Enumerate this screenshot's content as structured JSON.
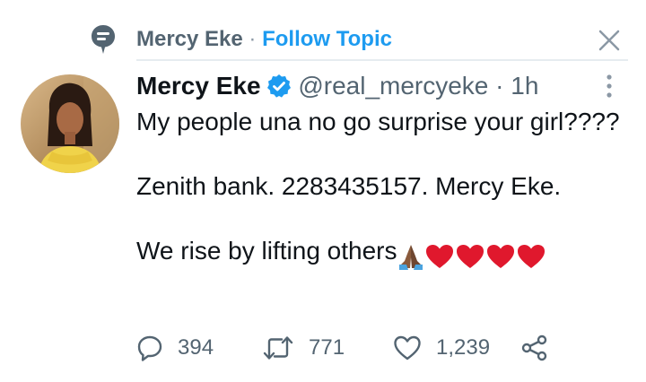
{
  "topic": {
    "name": "Mercy Eke",
    "separator": "·",
    "follow_label": "Follow Topic"
  },
  "tweet": {
    "author_name": "Mercy Eke",
    "handle": "@real_mercyeke",
    "separator": "·",
    "time": "1h",
    "text_line1": "My people una no go surprise your girl????",
    "text_line2": "Zenith bank. 2283435157. Mercy Eke.",
    "text_line3": "We rise by lifting others",
    "emojis": [
      "praying-hands",
      "red-heart",
      "red-heart",
      "red-heart",
      "red-heart"
    ]
  },
  "actions": {
    "replies": "394",
    "retweets": "771",
    "likes": "1,239"
  },
  "colors": {
    "accent": "#1d9bf0",
    "muted": "#536471",
    "heart": "#e0182d"
  }
}
